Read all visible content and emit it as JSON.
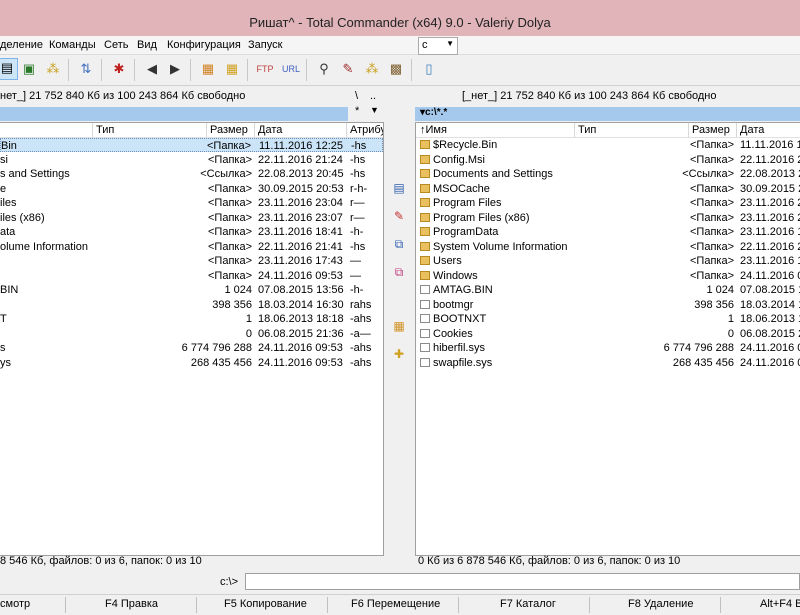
{
  "window": {
    "title": "Ришат^ - Total Commander (x64) 9.0 - Valeriy Dolya"
  },
  "menu": [
    "деление",
    "Команды",
    "Сеть",
    "Вид",
    "Конфигурация",
    "Запуск"
  ],
  "left_panel": {
    "drive_info": "нет_]  21 752 840 Кб из 100 243 864 Кб свободно",
    "path_ctl_root": "\\",
    "path_ctl_up": "..",
    "path_ctl_star": "*",
    "path_ctl_arrow": "▼",
    "headers": {
      "name": "",
      "type": "Тип",
      "size": "Размер",
      "date": "Дата",
      "attr": "Атрибу"
    },
    "rows": [
      {
        "name": "Bin",
        "size": "<Папка>",
        "date": "11.11.2016 12:25",
        "attr": "-hs",
        "icon": "folder"
      },
      {
        "name": "si",
        "size": "<Папка>",
        "date": "22.11.2016 21:24",
        "attr": "-hs",
        "icon": "folder"
      },
      {
        "name": "s and Settings",
        "size": "<Ссылка>",
        "date": "22.08.2013 20:45",
        "attr": "-hs",
        "icon": "link"
      },
      {
        "name": "e",
        "size": "<Папка>",
        "date": "30.09.2015 20:53",
        "attr": "r-h-",
        "icon": "folder"
      },
      {
        "name": "iles",
        "size": "<Папка>",
        "date": "23.11.2016 23:04",
        "attr": "r—",
        "icon": "folder"
      },
      {
        "name": "iles (x86)",
        "size": "<Папка>",
        "date": "23.11.2016 23:07",
        "attr": "r—",
        "icon": "folder"
      },
      {
        "name": "ata",
        "size": "<Папка>",
        "date": "23.11.2016 18:41",
        "attr": "-h-",
        "icon": "folder"
      },
      {
        "name": "olume Information",
        "size": "<Папка>",
        "date": "22.11.2016 21:41",
        "attr": "-hs",
        "icon": "folder"
      },
      {
        "name": "",
        "size": "<Папка>",
        "date": "23.11.2016 17:43",
        "attr": "—",
        "icon": "folder"
      },
      {
        "name": "",
        "size": "<Папка>",
        "date": "24.11.2016 09:53",
        "attr": "—",
        "icon": "folder"
      },
      {
        "name": "BIN",
        "size": "1 024",
        "date": "07.08.2015 13:56",
        "attr": "-h-",
        "icon": "file"
      },
      {
        "name": "",
        "size": "398 356",
        "date": "18.03.2014 16:30",
        "attr": "rahs",
        "icon": "file"
      },
      {
        "name": "T",
        "size": "1",
        "date": "18.06.2013 18:18",
        "attr": "-ahs",
        "icon": "file"
      },
      {
        "name": "",
        "size": "0",
        "date": "06.08.2015 21:36",
        "attr": "-a—",
        "icon": "file"
      },
      {
        "name": "s",
        "size": "6 774 796 288",
        "date": "24.11.2016 09:53",
        "attr": "-ahs",
        "icon": "file"
      },
      {
        "name": "ys",
        "size": "268 435 456",
        "date": "24.11.2016 09:53",
        "attr": "-ahs",
        "icon": "file"
      }
    ],
    "status": "8 546 Кб, файлов: 0 из 6, папок: 0 из 10"
  },
  "right_panel": {
    "drive": "c",
    "drive_info": "[_нет_]  21 752 840 Кб из 100 243 864 Кб свободно",
    "path": "▾c:\\*.*",
    "headers": {
      "name": "↑Имя",
      "type": "Тип",
      "size": "Размер",
      "date": "Дата"
    },
    "rows": [
      {
        "name": "$Recycle.Bin",
        "size": "<Папка>",
        "date": "11.11.2016 1",
        "icon": "folder"
      },
      {
        "name": "Config.Msi",
        "size": "<Папка>",
        "date": "22.11.2016 2",
        "icon": "folder"
      },
      {
        "name": "Documents and Settings",
        "size": "<Ссылка>",
        "date": "22.08.2013 2",
        "icon": "link"
      },
      {
        "name": "MSOCache",
        "size": "<Папка>",
        "date": "30.09.2015 2",
        "icon": "folder"
      },
      {
        "name": "Program Files",
        "size": "<Папка>",
        "date": "23.11.2016 2",
        "icon": "folder"
      },
      {
        "name": "Program Files (x86)",
        "size": "<Папка>",
        "date": "23.11.2016 2",
        "icon": "folder"
      },
      {
        "name": "ProgramData",
        "size": "<Папка>",
        "date": "23.11.2016 1",
        "icon": "folder"
      },
      {
        "name": "System Volume Information",
        "size": "<Папка>",
        "date": "22.11.2016 2",
        "icon": "folder"
      },
      {
        "name": "Users",
        "size": "<Папка>",
        "date": "23.11.2016 1",
        "icon": "folder"
      },
      {
        "name": "Windows",
        "size": "<Папка>",
        "date": "24.11.2016 0",
        "icon": "folder"
      },
      {
        "name": "AMTAG.BIN",
        "size": "1 024",
        "date": "07.08.2015 1",
        "icon": "file"
      },
      {
        "name": "bootmgr",
        "size": "398 356",
        "date": "18.03.2014 1",
        "icon": "file"
      },
      {
        "name": "BOOTNXT",
        "size": "1",
        "date": "18.06.2013 1",
        "icon": "file"
      },
      {
        "name": "Cookies",
        "size": "0",
        "date": "06.08.2015 2",
        "icon": "file"
      },
      {
        "name": "hiberfil.sys",
        "size": "6 774 796 288",
        "date": "24.11.2016 0",
        "icon": "file"
      },
      {
        "name": "swapfile.sys",
        "size": "268 435 456",
        "date": "24.11.2016 0",
        "icon": "file"
      }
    ],
    "status": "0 Кб из 6 878 546 Кб, файлов: 0 из 6, папок: 0 из 10"
  },
  "command_line": {
    "label": "c:\\>",
    "value": ""
  },
  "fkeys": [
    "смотр",
    "F4 Правка",
    "F5 Копирование",
    "F6 Перемещение",
    "F7 Каталог",
    "F8 Удаление",
    "Alt+F4 В"
  ]
}
